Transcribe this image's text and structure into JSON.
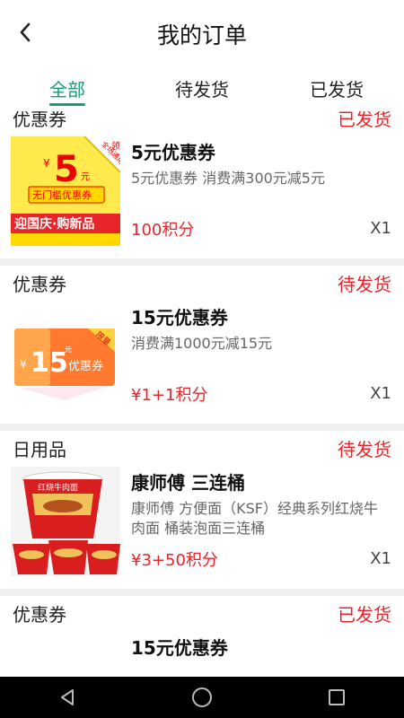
{
  "header": {
    "title": "我的订单",
    "back_icon": "chevron-left-icon"
  },
  "tabs": [
    {
      "label": "全部",
      "active": true
    },
    {
      "label": "待发货",
      "active": false
    },
    {
      "label": "已发货",
      "active": false
    }
  ],
  "orders": [
    {
      "category": "优惠券",
      "status": "已发货",
      "name": "5元优惠券",
      "desc": "5元优惠券   消费满300元减5元",
      "price": "100积分",
      "qty": "X1",
      "thumb": {
        "top_badge": "领",
        "corner": "全场通用",
        "amount_prefix": "¥",
        "amount": "5",
        "unit": "元",
        "label": "无门槛优惠券",
        "banner": "迎国庆·购新品"
      }
    },
    {
      "category": "优惠券",
      "status": "待发货",
      "name": "15元优惠券",
      "desc": "消费满1000元减15元",
      "price": "¥1+1积分",
      "qty": "X1",
      "thumb": {
        "corner": "限量",
        "amount_prefix": "¥",
        "amount": "15",
        "unit": "元",
        "label": "优惠券"
      }
    },
    {
      "category": "日用品",
      "status": "待发货",
      "name": "康师傅 三连桶",
      "desc": "康师傅 方便面（KSF）经典系列红烧牛肉面 桶装泡面三连桶",
      "price": "¥3+50积分",
      "qty": "X1",
      "thumb": {
        "label": "红烧牛肉面"
      }
    },
    {
      "category": "优惠券",
      "status": "已发货",
      "name": "15元优惠券"
    }
  ],
  "navbar": {
    "icons": [
      "back-triangle-icon",
      "home-circle-icon",
      "recents-square-icon"
    ]
  },
  "colors": {
    "accent": "#1a9b7a",
    "status_red": "#e8252a"
  }
}
